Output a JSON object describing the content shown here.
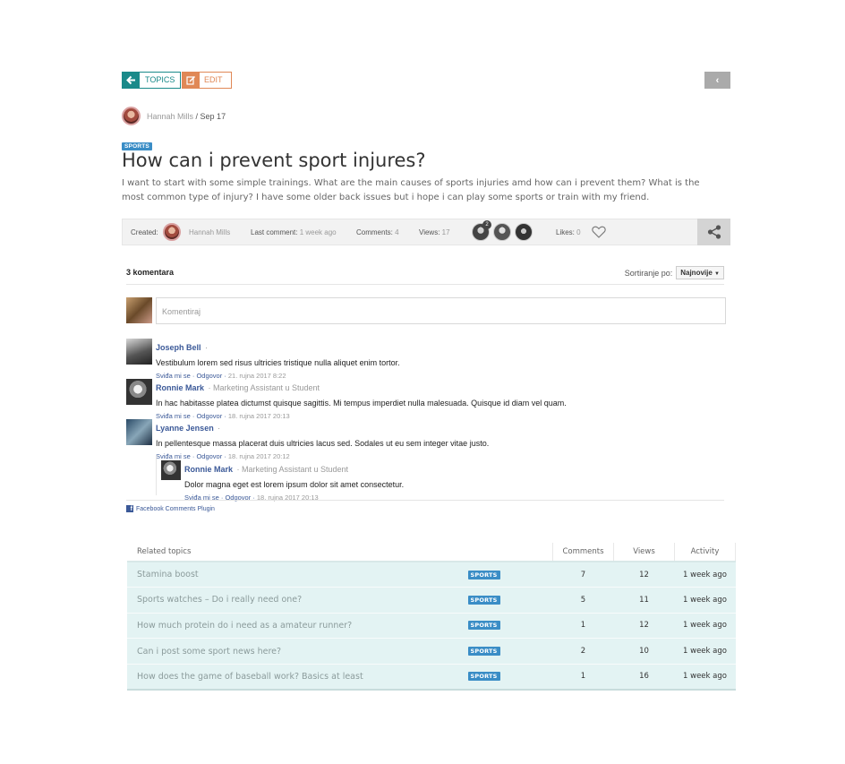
{
  "toolbar": {
    "topics_label": "TOPICS",
    "edit_label": "EDIT",
    "back_glyph": "‹"
  },
  "post": {
    "author": "Hannah Mills",
    "date": "Sep 17",
    "tag": "SPORTS",
    "title": "How can i prevent sport injures?",
    "body": "I want to start with some simple trainings. What are the main causes of sports injuries amd how can i prevent them? What is the most common type of injury? I have some older back issues but i hope i can play some sports or train with my friend."
  },
  "meta": {
    "created_label": "Created:",
    "created_by": "Hannah Mills",
    "last_comment_label": "Last comment:",
    "last_comment_value": "1 week ago",
    "comments_label": "Comments:",
    "comments_value": "4",
    "views_label": "Views:",
    "views_value": "17",
    "participant_badge": "2",
    "likes_label": "Likes:",
    "likes_value": "0",
    "icons": [
      "heart-icon",
      "share-icon"
    ]
  },
  "comments": {
    "count_label": "3 komentara",
    "sort_label": "Sortiranje po:",
    "sort_value": "Najnovije",
    "placeholder": "Komentiraj",
    "like_label": "Sviđa mi se",
    "reply_label": "Odgovor",
    "items": [
      {
        "author": "Joseph Bell",
        "role": "",
        "text": "Vestibulum lorem sed risus ultricies tristique nulla aliquet enim tortor.",
        "time": "21. rujna 2017 8:22"
      },
      {
        "author": "Ronnie Mark",
        "role": "Marketing Assistant u Student",
        "text": "In hac habitasse platea dictumst quisque sagittis. Mi tempus imperdiet nulla malesuada. Quisque id diam vel quam.",
        "time": "18. rujna 2017 20:13"
      },
      {
        "author": "Lyanne Jensen",
        "role": "",
        "text": "In pellentesque massa placerat duis ultricies lacus sed. Sodales ut eu sem integer vitae justo.",
        "time": "18. rujna 2017 20:12"
      },
      {
        "author": "Ronnie Mark",
        "role": "Marketing Assistant u Student",
        "text": "Dolor magna eget est lorem ipsum dolor sit amet consectetur.",
        "time": "18. rujna 2017 20:13"
      }
    ],
    "plugin_label": "Facebook Comments Plugin"
  },
  "related": {
    "headers": [
      "Related topics",
      "Comments",
      "Views",
      "Activity"
    ],
    "rows": [
      {
        "title": "Stamina boost",
        "tag": "SPORTS",
        "comments": "7",
        "views": "12",
        "activity": "1 week ago"
      },
      {
        "title": "Sports watches – Do i really need one?",
        "tag": "SPORTS",
        "comments": "5",
        "views": "11",
        "activity": "1 week ago"
      },
      {
        "title": "How much protein do i need as a amateur runner?",
        "tag": "SPORTS",
        "comments": "1",
        "views": "12",
        "activity": "1 week ago"
      },
      {
        "title": "Can i post some sport news here?",
        "tag": "SPORTS",
        "comments": "2",
        "views": "10",
        "activity": "1 week ago"
      },
      {
        "title": "How does the game of baseball work? Basics at least",
        "tag": "SPORTS",
        "comments": "1",
        "views": "16",
        "activity": "1 week ago"
      }
    ]
  },
  "colors": {
    "teal": "#1a8a8a",
    "orange": "#e08856",
    "tag_blue": "#3a8dc6",
    "fb_blue": "#3b5998",
    "related_bg": "#e3f3f3"
  }
}
